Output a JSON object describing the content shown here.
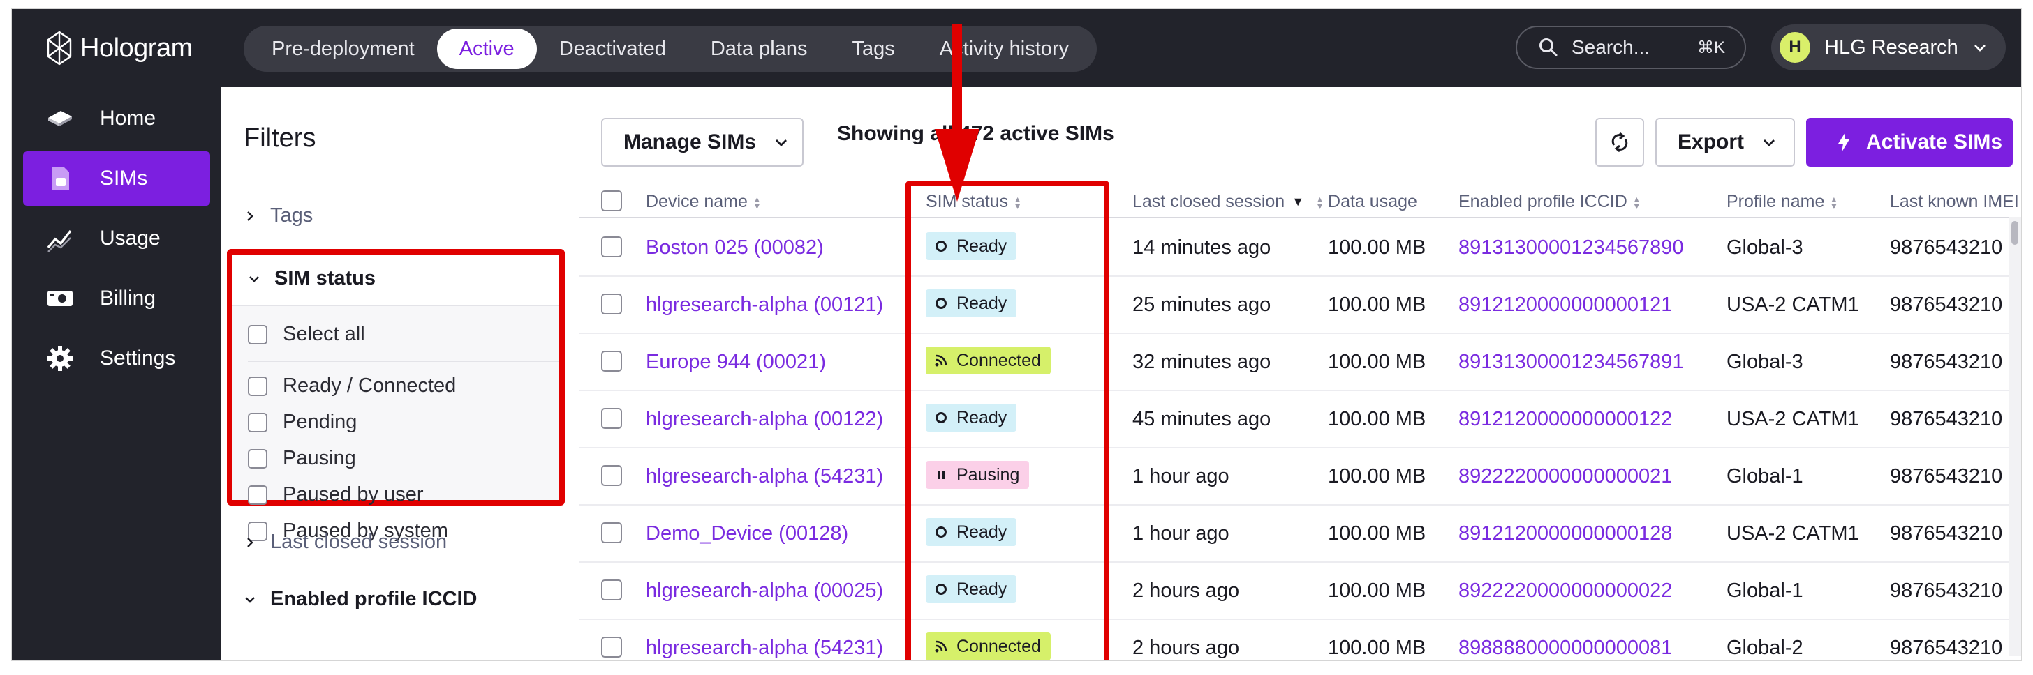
{
  "app": {
    "name": "Hologram"
  },
  "top_tabs": [
    {
      "label": "Pre-deployment",
      "active": false
    },
    {
      "label": "Active",
      "active": true
    },
    {
      "label": "Deactivated",
      "active": false
    },
    {
      "label": "Data plans",
      "active": false
    },
    {
      "label": "Tags",
      "active": false
    },
    {
      "label": "Activity history",
      "active": false
    }
  ],
  "search": {
    "placeholder": "Search...",
    "shortcut": "⌘K"
  },
  "account": {
    "initial": "H",
    "name": "HLG Research"
  },
  "sidebar": {
    "items": [
      {
        "label": "Home",
        "icon": "home-icon",
        "active": false
      },
      {
        "label": "SIMs",
        "icon": "sim-icon",
        "active": true
      },
      {
        "label": "Usage",
        "icon": "usage-icon",
        "active": false
      },
      {
        "label": "Billing",
        "icon": "billing-icon",
        "active": false
      },
      {
        "label": "Settings",
        "icon": "gear-icon",
        "active": false
      }
    ]
  },
  "filters": {
    "title": "Filters",
    "tags_label": "Tags",
    "sim_status": {
      "label": "SIM status",
      "select_all": "Select all",
      "options": [
        "Ready / Connected",
        "Pending",
        "Pausing",
        "Paused by user",
        "Paused by system"
      ]
    },
    "last_closed_session_label": "Last closed session",
    "enabled_profile_iccid_label": "Enabled profile ICCID"
  },
  "toolbar": {
    "manage_label": "Manage SIMs",
    "showing_text": "Showing all 472 active SIMs",
    "refresh_icon": "refresh-icon",
    "export_label": "Export",
    "activate_label": "Activate SIMs"
  },
  "table": {
    "columns": [
      "Device name",
      "SIM status",
      "Last closed session",
      "Data usage",
      "Enabled profile ICCID",
      "Profile name",
      "Last known IMEI"
    ],
    "rows": [
      {
        "device": "Boston 025 (00082)",
        "status": "Ready",
        "last": "14 minutes ago",
        "usage": "100.00 MB",
        "iccid": "89131300001234567890",
        "profile": "Global-3",
        "imei": "9876543210"
      },
      {
        "device": "hlgresearch-alpha (00121)",
        "status": "Ready",
        "last": "25 minutes ago",
        "usage": "100.00 MB",
        "iccid": "8912120000000000121",
        "profile": "USA-2 CATM1",
        "imei": "9876543210"
      },
      {
        "device": "Europe 944 (00021)",
        "status": "Connected",
        "last": "32 minutes ago",
        "usage": "100.00 MB",
        "iccid": "89131300001234567891",
        "profile": "Global-3",
        "imei": "9876543210"
      },
      {
        "device": "hlgresearch-alpha (00122)",
        "status": "Ready",
        "last": "45 minutes ago",
        "usage": "100.00 MB",
        "iccid": "8912120000000000122",
        "profile": "USA-2 CATM1",
        "imei": "9876543210"
      },
      {
        "device": "hlgresearch-alpha (54231)",
        "status": "Pausing",
        "last": "1 hour ago",
        "usage": "100.00 MB",
        "iccid": "8922220000000000021",
        "profile": "Global-1",
        "imei": "9876543210"
      },
      {
        "device": "Demo_Device (00128)",
        "status": "Ready",
        "last": "1 hour ago",
        "usage": "100.00 MB",
        "iccid": "8912120000000000128",
        "profile": "USA-2 CATM1",
        "imei": "9876543210"
      },
      {
        "device": "hlgresearch-alpha (00025)",
        "status": "Ready",
        "last": "2 hours ago",
        "usage": "100.00 MB",
        "iccid": "8922220000000000022",
        "profile": "Global-1",
        "imei": "9876543210"
      },
      {
        "device": "hlgresearch-alpha (54231)",
        "status": "Connected",
        "last": "2 hours ago",
        "usage": "100.00 MB",
        "iccid": "8988880000000000081",
        "profile": "Global-2",
        "imei": "9876543210"
      }
    ]
  },
  "colors": {
    "accent": "#7c1fe0",
    "annotation": "#e00000",
    "ready": "#d3f0f8",
    "connected": "#d6f06a",
    "pausing": "#fbd0e8"
  }
}
